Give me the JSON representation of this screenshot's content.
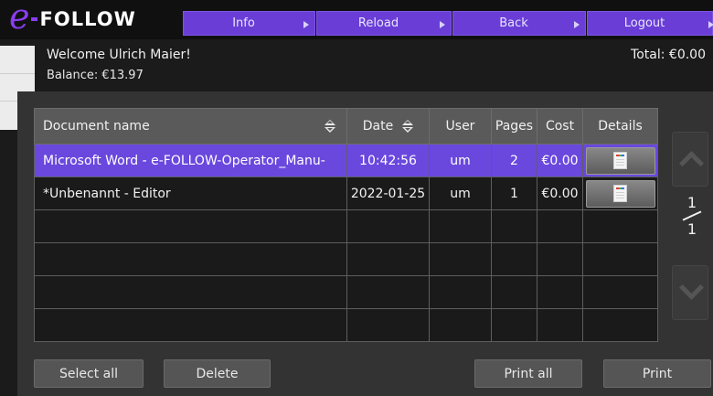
{
  "brand": {
    "logo_letter": "e",
    "logo_text": "FOLLOW"
  },
  "nav": {
    "info": "Info",
    "reload": "Reload",
    "back": "Back",
    "logout": "Logout"
  },
  "user": {
    "welcome": "Welcome Ulrich Maier!",
    "balance": "Balance: €13.97",
    "total": "Total: €0.00"
  },
  "table": {
    "columns": [
      "Document name",
      "Date",
      "User",
      "Pages",
      "Cost",
      "Details"
    ],
    "rows": [
      {
        "name": "Microsoft Word - e-FOLLOW-Operator_Manu-",
        "date": "10:42:56",
        "user": "um",
        "pages": "2",
        "cost": "€0.00",
        "selected": true
      },
      {
        "name": "*Unbenannt - Editor",
        "date": "2022-01-25",
        "user": "um",
        "pages": "1",
        "cost": "€0.00",
        "selected": false
      }
    ]
  },
  "pager": {
    "current": "1",
    "total": "1"
  },
  "actions": {
    "select_all": "Select all",
    "delete": "Delete",
    "print_all": "Print all",
    "print": "Print"
  },
  "colors": {
    "accent": "#6a3ed6",
    "selected_row": "#6a48de",
    "logo": "#8a3df0"
  }
}
